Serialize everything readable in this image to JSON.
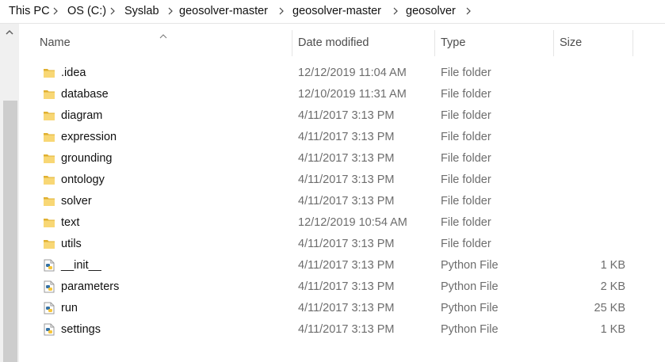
{
  "breadcrumb": [
    "This PC",
    "OS (C:)",
    "Syslab",
    "geosolver-master",
    "geosolver-master",
    "geosolver"
  ],
  "columns": {
    "name": "Name",
    "date": "Date modified",
    "type": "Type",
    "size": "Size"
  },
  "files": [
    {
      "name": ".idea",
      "date": "12/12/2019 11:04 AM",
      "type": "File folder",
      "size": "",
      "icon": "folder-icon"
    },
    {
      "name": "database",
      "date": "12/10/2019 11:31 AM",
      "type": "File folder",
      "size": "",
      "icon": "folder-icon"
    },
    {
      "name": "diagram",
      "date": "4/11/2017 3:13 PM",
      "type": "File folder",
      "size": "",
      "icon": "folder-icon"
    },
    {
      "name": "expression",
      "date": "4/11/2017 3:13 PM",
      "type": "File folder",
      "size": "",
      "icon": "folder-icon"
    },
    {
      "name": "grounding",
      "date": "4/11/2017 3:13 PM",
      "type": "File folder",
      "size": "",
      "icon": "folder-icon"
    },
    {
      "name": "ontology",
      "date": "4/11/2017 3:13 PM",
      "type": "File folder",
      "size": "",
      "icon": "folder-icon"
    },
    {
      "name": "solver",
      "date": "4/11/2017 3:13 PM",
      "type": "File folder",
      "size": "",
      "icon": "folder-icon"
    },
    {
      "name": "text",
      "date": "12/12/2019 10:54 AM",
      "type": "File folder",
      "size": "",
      "icon": "folder-icon"
    },
    {
      "name": "utils",
      "date": "4/11/2017 3:13 PM",
      "type": "File folder",
      "size": "",
      "icon": "folder-icon"
    },
    {
      "name": "__init__",
      "date": "4/11/2017 3:13 PM",
      "type": "Python File",
      "size": "1 KB",
      "icon": "python-file-icon"
    },
    {
      "name": "parameters",
      "date": "4/11/2017 3:13 PM",
      "type": "Python File",
      "size": "2 KB",
      "icon": "python-file-icon"
    },
    {
      "name": "run",
      "date": "4/11/2017 3:13 PM",
      "type": "Python File",
      "size": "25 KB",
      "icon": "python-file-icon"
    },
    {
      "name": "settings",
      "date": "4/11/2017 3:13 PM",
      "type": "Python File",
      "size": "1 KB",
      "icon": "python-file-icon"
    }
  ],
  "colors": {
    "folder": "#f8d775",
    "folder_dark": "#e0b030",
    "python_blue": "#3572a5",
    "python_yellow": "#f7c63a"
  }
}
